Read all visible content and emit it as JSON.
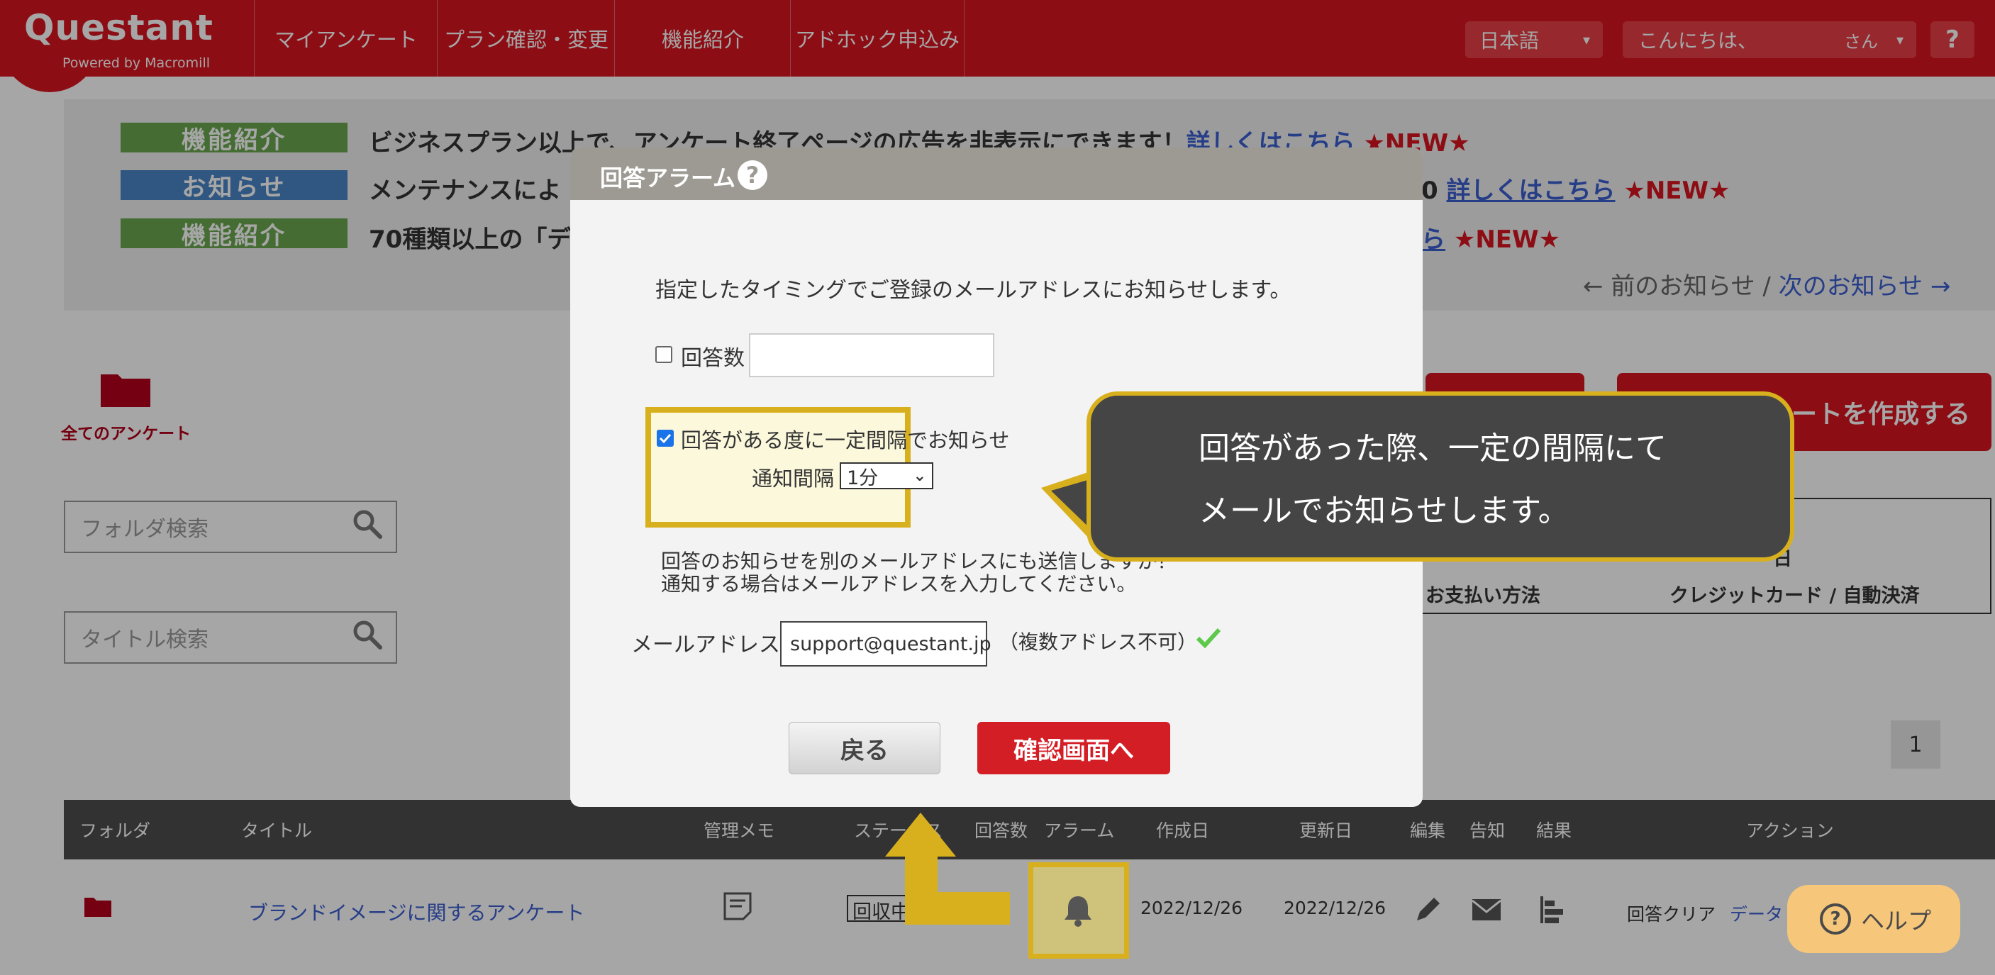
{
  "header": {
    "logo": "Questant",
    "logo_sub": "Powered by Macromill",
    "nav": [
      "マイアンケート",
      "プラン確認・変更",
      "機能紹介",
      "アドホック申込み"
    ],
    "language": "日本語",
    "greeting": "こんにちは、",
    "greeting_suffix": "さん",
    "help": "?"
  },
  "notices": [
    {
      "badge": "機能紹介",
      "badge_color": "#6aa84f",
      "text": "ビジネスプラン以上で、アンケート終了ページの広告を非表示にできます！",
      "link": "詳しくはこちら",
      "new": "★NEW★"
    },
    {
      "badge": "お知らせ",
      "badge_color": "#4a86c8",
      "text": "メンテナンスによ",
      "suffix": "0",
      "link": "詳しくはこちら",
      "new": "★NEW★"
    },
    {
      "badge": "機能紹介",
      "badge_color": "#6aa84f",
      "text": "70種類以上の「デ",
      "link": "ら",
      "new": "★NEW★"
    }
  ],
  "notice_nav": {
    "prev": "← 前のお知らせ",
    "sep": " / ",
    "next": "次のお知らせ →"
  },
  "sidebar": {
    "all_surveys": "全てのアンケート",
    "folder_search_placeholder": "フォルダ検索",
    "title_search_placeholder": "タイトル検索"
  },
  "create_button_partial": "ートを作成する",
  "plan_box": {
    "row1_value": "日",
    "row2_label": "お支払い方法",
    "row2_value": "クレジットカード / 自動決済"
  },
  "pagination": {
    "current": "1"
  },
  "table": {
    "headers": [
      "フォルダ",
      "タイトル",
      "管理メモ",
      "ステータス",
      "回答数",
      "アラーム",
      "作成日",
      "更新日",
      "編集",
      "告知",
      "結果",
      "アクション"
    ],
    "row": {
      "title": "ブランドイメージに関するアンケート",
      "status": "回収中",
      "created": "2022/12/26",
      "updated": "2022/12/26",
      "action_clear": "回答クリア",
      "action_data": "データ"
    }
  },
  "help_button": "ヘルプ",
  "modal": {
    "title": "回答アラーム",
    "help": "?",
    "description": "指定したタイミングでご登録のメールアドレスにお知らせします。",
    "count_label": "回答数",
    "count_checked": false,
    "interval_label": "回答がある度に一定間隔でお知らせ",
    "interval_checked": true,
    "interval_field_label": "通知間隔",
    "interval_value": "1分",
    "other_email_line1": "回答のお知らせを別のメールアドレスにも送信しますか？",
    "other_email_line2": "通知する場合はメールアドレスを入力してください。",
    "email_label": "メールアドレス",
    "email_value": "support@questant.jp",
    "email_note": "（複数アドレス不可）",
    "back_button": "戻る",
    "confirm_button": "確認画面へ"
  },
  "callout": {
    "line1": "回答があった際、一定の間隔にて",
    "line2": "メールでお知らせします。"
  },
  "colors": {
    "brand_red": "#d9141f",
    "highlight_gold": "#d8b01e",
    "highlight_fill": "#fbf8dc",
    "callout_bg": "#454545"
  }
}
